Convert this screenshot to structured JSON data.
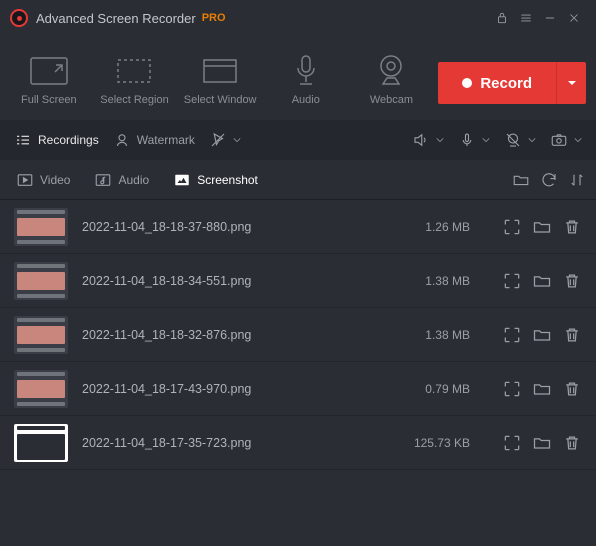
{
  "app": {
    "title": "Advanced Screen Recorder",
    "pro": "PRO"
  },
  "modes": {
    "fullscreen": "Full Screen",
    "region": "Select Region",
    "window": "Select Window",
    "audio": "Audio",
    "webcam": "Webcam"
  },
  "record_label": "Record",
  "toolbar": {
    "recordings": "Recordings",
    "watermark": "Watermark"
  },
  "tabs": {
    "video": "Video",
    "audio": "Audio",
    "screenshot": "Screenshot"
  },
  "files": [
    {
      "name": "2022-11-04_18-18-37-880.png",
      "size": "1.26 MB"
    },
    {
      "name": "2022-11-04_18-18-34-551.png",
      "size": "1.38 MB"
    },
    {
      "name": "2022-11-04_18-18-32-876.png",
      "size": "1.38 MB"
    },
    {
      "name": "2022-11-04_18-17-43-970.png",
      "size": "0.79 MB"
    },
    {
      "name": "2022-11-04_18-17-35-723.png",
      "size": "125.73 KB"
    }
  ]
}
